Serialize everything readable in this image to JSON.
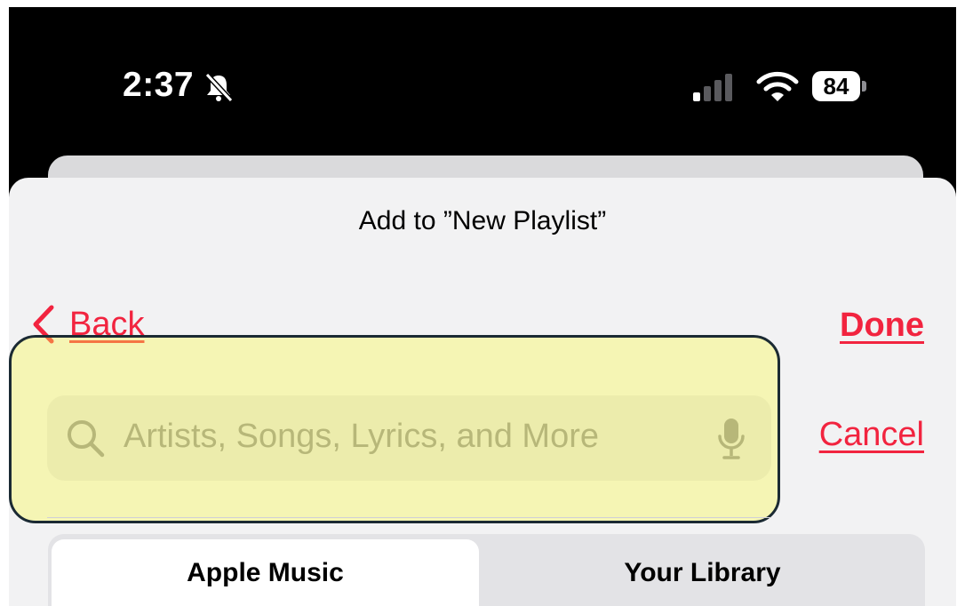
{
  "status_bar": {
    "time": "2:37",
    "battery_level": "84",
    "icons": [
      "bell-slash-icon",
      "cellular-signal-icon",
      "wifi-icon",
      "battery-icon"
    ]
  },
  "sheet": {
    "title": "Add to ”New Playlist”"
  },
  "nav": {
    "back_label": "Back",
    "done_label": "Done"
  },
  "search": {
    "placeholder": "Artists, Songs, Lyrics, and More",
    "cancel_label": "Cancel"
  },
  "segments": {
    "items": [
      {
        "label": "Apple Music",
        "selected": true
      },
      {
        "label": "Your Library",
        "selected": false
      }
    ]
  },
  "colors": {
    "accent": "#f2243f",
    "highlight": "#f5f55a"
  }
}
